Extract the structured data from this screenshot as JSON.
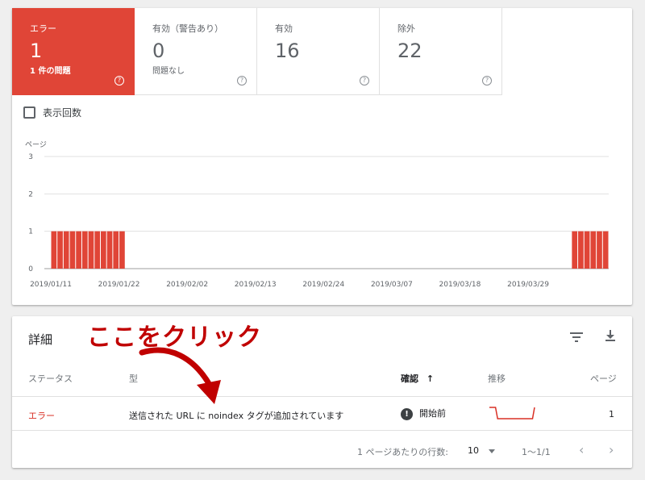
{
  "tiles": [
    {
      "label": "エラー",
      "value": "1",
      "sub": "1 件の問題",
      "active": true
    },
    {
      "label": "有効（警告あり）",
      "value": "0",
      "sub": "問題なし",
      "active": false
    },
    {
      "label": "有効",
      "value": "16",
      "sub": "",
      "active": false
    },
    {
      "label": "除外",
      "value": "22",
      "sub": "",
      "active": false
    }
  ],
  "help_glyph": "?",
  "impressions_label": "表示回数",
  "chart_data": {
    "type": "bar",
    "ylabel": "ページ",
    "yticks": [
      0,
      1,
      2,
      3
    ],
    "ylim": [
      0,
      3
    ],
    "xticks": [
      "2019/01/11",
      "2019/01/22",
      "2019/02/02",
      "2019/02/13",
      "2019/02/24",
      "2019/03/07",
      "2019/03/18",
      "2019/03/29"
    ],
    "start_date": "2019/01/11",
    "values": [
      1,
      1,
      1,
      1,
      1,
      1,
      1,
      1,
      1,
      1,
      1,
      1,
      0,
      0,
      0,
      0,
      0,
      0,
      0,
      0,
      0,
      0,
      0,
      0,
      0,
      0,
      0,
      0,
      0,
      0,
      0,
      0,
      0,
      0,
      0,
      0,
      0,
      0,
      0,
      0,
      0,
      0,
      0,
      0,
      0,
      0,
      0,
      0,
      0,
      0,
      0,
      0,
      0,
      0,
      0,
      0,
      0,
      0,
      0,
      0,
      0,
      0,
      0,
      0,
      0,
      0,
      0,
      0,
      0,
      0,
      0,
      0,
      0,
      0,
      0,
      0,
      0,
      0,
      0,
      0,
      0,
      0,
      0,
      0,
      1,
      1,
      1,
      1,
      1,
      1
    ],
    "grid": true,
    "color": "#e04537"
  },
  "details": {
    "title": "詳細",
    "columns": {
      "status": "ステータス",
      "type": "型",
      "validation": "確認",
      "sort_arrow": "↑",
      "trend": "推移",
      "pages": "ページ"
    },
    "rows": [
      {
        "status": "エラー",
        "type": "送信された URL に noindex タグが追加されています",
        "validation": "開始前",
        "pages": "1",
        "trend": [
          1,
          1,
          1,
          1,
          0,
          0,
          0,
          0,
          0,
          0,
          0,
          0,
          0,
          0,
          0,
          0,
          0,
          0,
          0,
          0,
          0,
          0,
          1
        ]
      }
    ],
    "footer": {
      "rows_label": "1 ページあたりの行数:",
      "rows_value": "10",
      "range": "1〜1/1",
      "prev": "‹",
      "next": "›"
    }
  },
  "annotation": {
    "text": "ここをクリック",
    "color": "#c00000"
  }
}
